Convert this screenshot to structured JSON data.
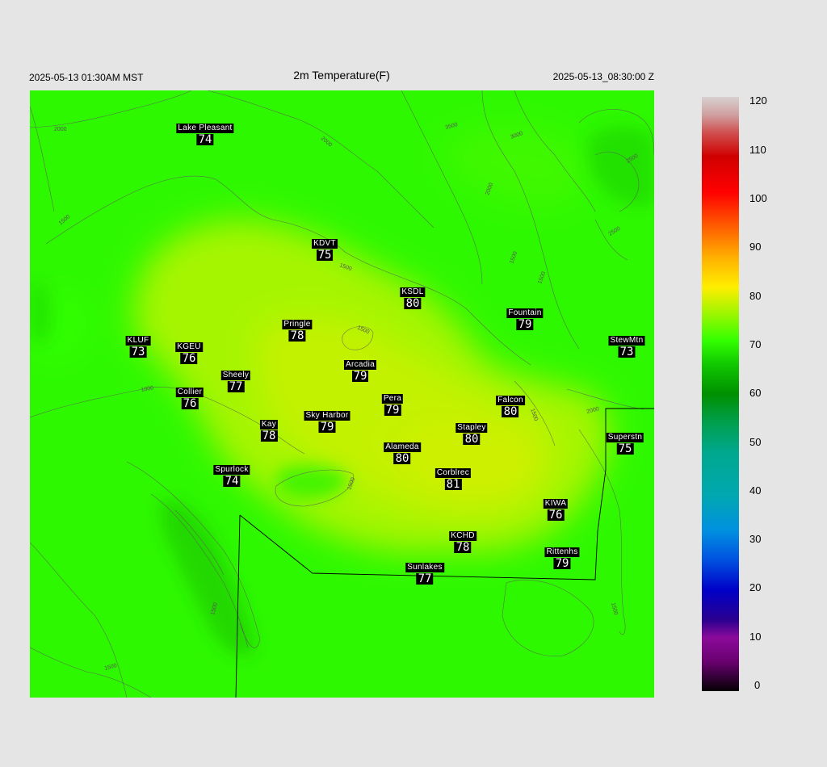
{
  "header": {
    "left": "2025-05-13 01:30AM MST",
    "title": "2m Temperature(F)",
    "right": "2025-05-13_08:30:00 Z"
  },
  "colorbar": {
    "ticks": [
      "0",
      "10",
      "20",
      "30",
      "40",
      "50",
      "60",
      "70",
      "80",
      "90",
      "100",
      "110",
      "120"
    ]
  },
  "contour_labels": [
    "2000",
    "2000",
    "3500",
    "3000",
    "2500",
    "2500",
    "2000",
    "1500",
    "1500",
    "1500",
    "1500",
    "1000",
    "1500",
    "1500",
    "2000",
    "1500",
    "1500",
    "1500",
    "1500"
  ],
  "stations": [
    {
      "name": "Lake Pleasant",
      "temp": "74"
    },
    {
      "name": "KDVT",
      "temp": "75"
    },
    {
      "name": "KSDL",
      "temp": "80"
    },
    {
      "name": "Fountain",
      "temp": "79"
    },
    {
      "name": "Pringle",
      "temp": "78"
    },
    {
      "name": "StewMtn",
      "temp": "73"
    },
    {
      "name": "KLUF",
      "temp": "73"
    },
    {
      "name": "KGEU",
      "temp": "76"
    },
    {
      "name": "Arcadia",
      "temp": "79"
    },
    {
      "name": "Sheely",
      "temp": "77"
    },
    {
      "name": "Collier",
      "temp": "76"
    },
    {
      "name": "Pera",
      "temp": "79"
    },
    {
      "name": "Falcon",
      "temp": "80"
    },
    {
      "name": "Sky Harbor",
      "temp": "79"
    },
    {
      "name": "Kay",
      "temp": "78"
    },
    {
      "name": "Stapley",
      "temp": "80"
    },
    {
      "name": "Superstn",
      "temp": "75"
    },
    {
      "name": "Alameda",
      "temp": "80"
    },
    {
      "name": "Spurlock",
      "temp": "74"
    },
    {
      "name": "Corblrec",
      "temp": "81"
    },
    {
      "name": "KIWA",
      "temp": "76"
    },
    {
      "name": "KCHD",
      "temp": "78"
    },
    {
      "name": "Rittenhs",
      "temp": "79"
    },
    {
      "name": "Sunlakes",
      "temp": "77"
    }
  ]
}
